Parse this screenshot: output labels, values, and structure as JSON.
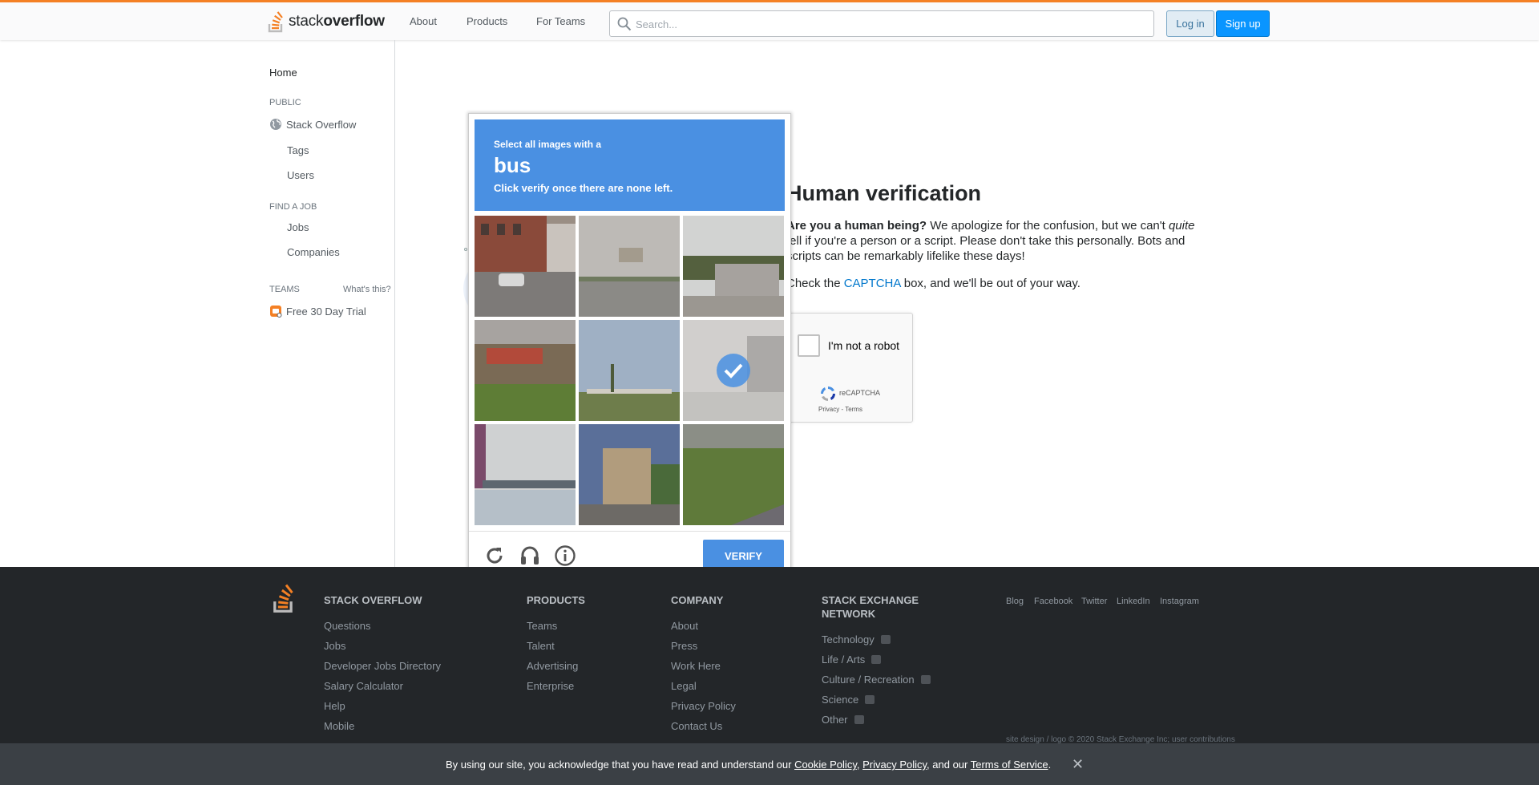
{
  "header": {
    "logo_light": "stack",
    "logo_bold": "overflow",
    "nav": [
      "About",
      "Products",
      "For Teams"
    ],
    "search_placeholder": "Search...",
    "login_label": "Log in",
    "signup_label": "Sign up"
  },
  "sidebar": {
    "home": "Home",
    "public_heading": "PUBLIC",
    "stack_overflow": "Stack Overflow",
    "tags": "Tags",
    "users": "Users",
    "find_job_heading": "FIND A JOB",
    "jobs": "Jobs",
    "companies": "Companies",
    "teams_heading": "TEAMS",
    "whats_this": "What's this?",
    "free_trial": "Free 30 Day Trial"
  },
  "main": {
    "title": "Human verification",
    "p1_bold": "Are you a human being?",
    "p1_a": " We apologize for the confusion, but we can't ",
    "p1_italic": "quite",
    "p1_b": " tell if you're a person or a script. Please don't take this personally. Bots and scripts can be remarkably lifelike these days!",
    "p2_a": "Check the ",
    "p2_link": "CAPTCHA",
    "p2_b": " box, and we'll be out of your way."
  },
  "recaptcha": {
    "label": "I'm not a robot",
    "brand": "reCAPTCHA",
    "terms": "Privacy - Terms"
  },
  "challenge": {
    "line1": "Select all images with a",
    "target": "bus",
    "line3": "Click verify once there are none left.",
    "verify_label": "VERIFY",
    "tiles_selected": [
      false,
      false,
      false,
      false,
      false,
      true,
      false,
      false,
      false
    ]
  },
  "footer": {
    "so_heading": "STACK OVERFLOW",
    "so_links": [
      "Questions",
      "Jobs",
      "Developer Jobs Directory",
      "Salary Calculator",
      "Help",
      "Mobile"
    ],
    "products_heading": "PRODUCTS",
    "products_links": [
      "Teams",
      "Talent",
      "Advertising",
      "Enterprise"
    ],
    "company_heading": "COMPANY",
    "company_links": [
      "About",
      "Press",
      "Work Here",
      "Legal",
      "Privacy Policy",
      "Contact Us"
    ],
    "network_heading_1": "STACK EXCHANGE",
    "network_heading_2": "NETWORK",
    "network_links": [
      "Technology",
      "Life / Arts",
      "Culture / Recreation",
      "Science",
      "Other"
    ],
    "social": [
      "Blog",
      "Facebook",
      "Twitter",
      "LinkedIn",
      "Instagram"
    ],
    "copyright": "site design / logo © 2020 Stack Exchange Inc; user contributions"
  },
  "cookie": {
    "text_a": "By using our site, you acknowledge that you have read and understand our ",
    "cookie_policy": "Cookie Policy",
    "sep1": ", ",
    "privacy_policy": "Privacy Policy",
    "sep2": ", and our ",
    "terms": "Terms of Service",
    "end": ".",
    "close": "✕"
  },
  "colors": {
    "accent_orange": "#f48024",
    "link_blue": "#0077cc",
    "captcha_blue": "#4a90e2",
    "footer_bg": "#232629"
  }
}
